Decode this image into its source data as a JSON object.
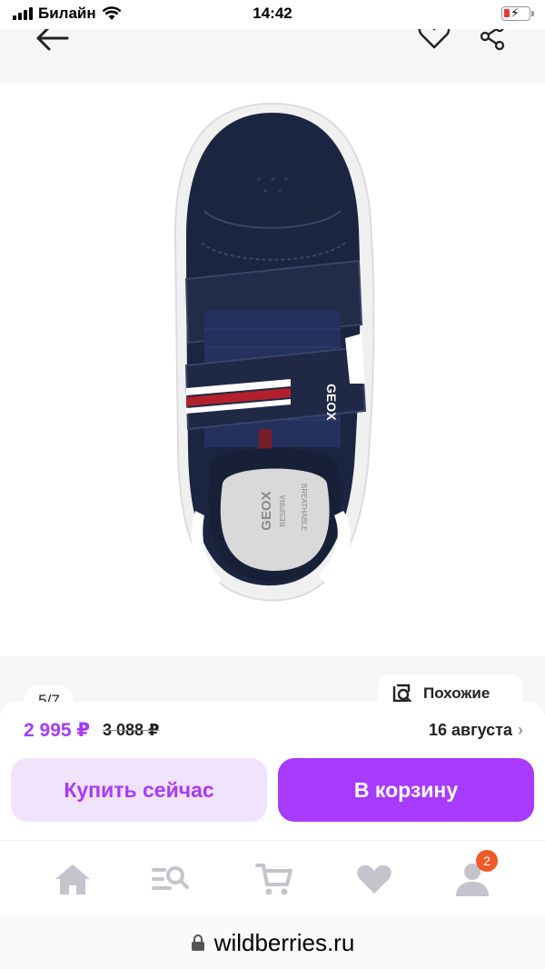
{
  "status_bar": {
    "carrier": "Билайн",
    "time": "14:42"
  },
  "gallery": {
    "counter": "5/7",
    "similar_label": "Похожие",
    "shoe_brand_tongue": "GEOX",
    "insole_text": "GEOX",
    "insole_sub": "RESPIRA",
    "insole_label": "BREATHABLE"
  },
  "buy_panel": {
    "price": "2 995 ₽",
    "old_price": "3 088 ₽",
    "delivery": "16 августа",
    "buy_now_label": "Купить сейчас",
    "add_to_cart_label": "В корзину"
  },
  "tab_bar": {
    "cart_badge": "2"
  },
  "url_bar": {
    "url": "wildberries.ru"
  },
  "colors": {
    "accent": "#a73afd",
    "accent_light": "#f2e3fd",
    "badge": "#f05a28"
  }
}
